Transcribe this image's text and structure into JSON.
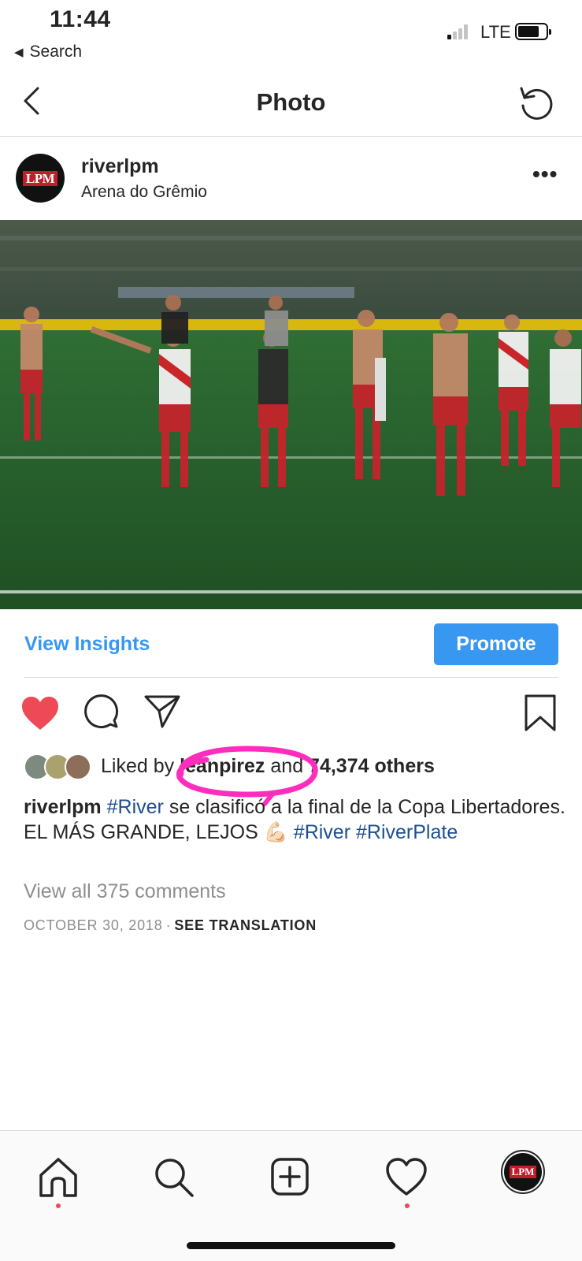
{
  "status_bar": {
    "time": "11:44",
    "back_app": "Search",
    "network": "LTE"
  },
  "nav": {
    "title": "Photo",
    "back_icon": "chevron-left-icon",
    "refresh_icon": "refresh-icon"
  },
  "post": {
    "username": "riverlpm",
    "location": "Arena do Grêmio",
    "avatar_text": "LPM",
    "more_label": "•••",
    "photo_icon": "photo"
  },
  "insights": {
    "view_insights_label": "View Insights",
    "promote_label": "Promote"
  },
  "actions": {
    "liked": true,
    "like_color": "#ed4956"
  },
  "likes": {
    "prefix": "Liked by ",
    "liker": "leanpirez",
    "middle": " and ",
    "count": "74,374 others",
    "highlight_color": "#ff2dbd"
  },
  "caption": {
    "username": "riverlpm",
    "tag1": "#River",
    "text": " se clasificó a la final de la Copa Libertadores. EL MÁS GRANDE, LEJOS 💪🏻 ",
    "tag2": "#River",
    "tag3": "#RiverPlate"
  },
  "comments": {
    "view_all_label": "View all 375 comments"
  },
  "meta": {
    "date": "OCTOBER 30, 2018",
    "separator": "·",
    "see_translation": "SEE TRANSLATION"
  },
  "tabbar": {
    "profile_text": "LPM"
  }
}
